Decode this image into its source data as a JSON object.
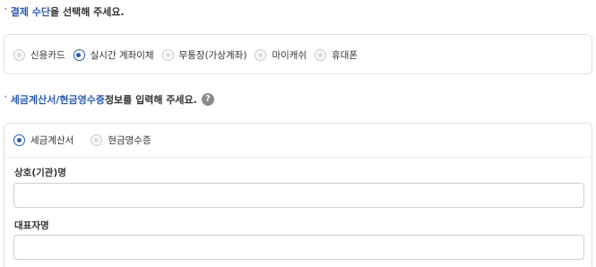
{
  "payment": {
    "title_highlight": "결제 수단",
    "title_rest": "을 선택해 주세요.",
    "options": [
      {
        "label": "신용카드",
        "selected": false
      },
      {
        "label": "실시간 계좌이체",
        "selected": true
      },
      {
        "label": "무통장(가상계좌)",
        "selected": false
      },
      {
        "label": "마이캐쉬",
        "selected": false
      },
      {
        "label": "휴대폰",
        "selected": false
      }
    ]
  },
  "tax": {
    "title_highlight": "세금계산서/현금영수증",
    "title_rest": " 정보를 입력해 주세요.",
    "help_icon": "?",
    "options": [
      {
        "label": "세금계산서",
        "selected": true
      },
      {
        "label": "현금영수증",
        "selected": false
      }
    ],
    "fields": {
      "company_label": "상호(기관)명",
      "company_value": "",
      "ceo_label": "대표자명",
      "ceo_value": ""
    }
  },
  "colors": {
    "accent": "#2c5dae",
    "border": "#e0e0e0"
  }
}
